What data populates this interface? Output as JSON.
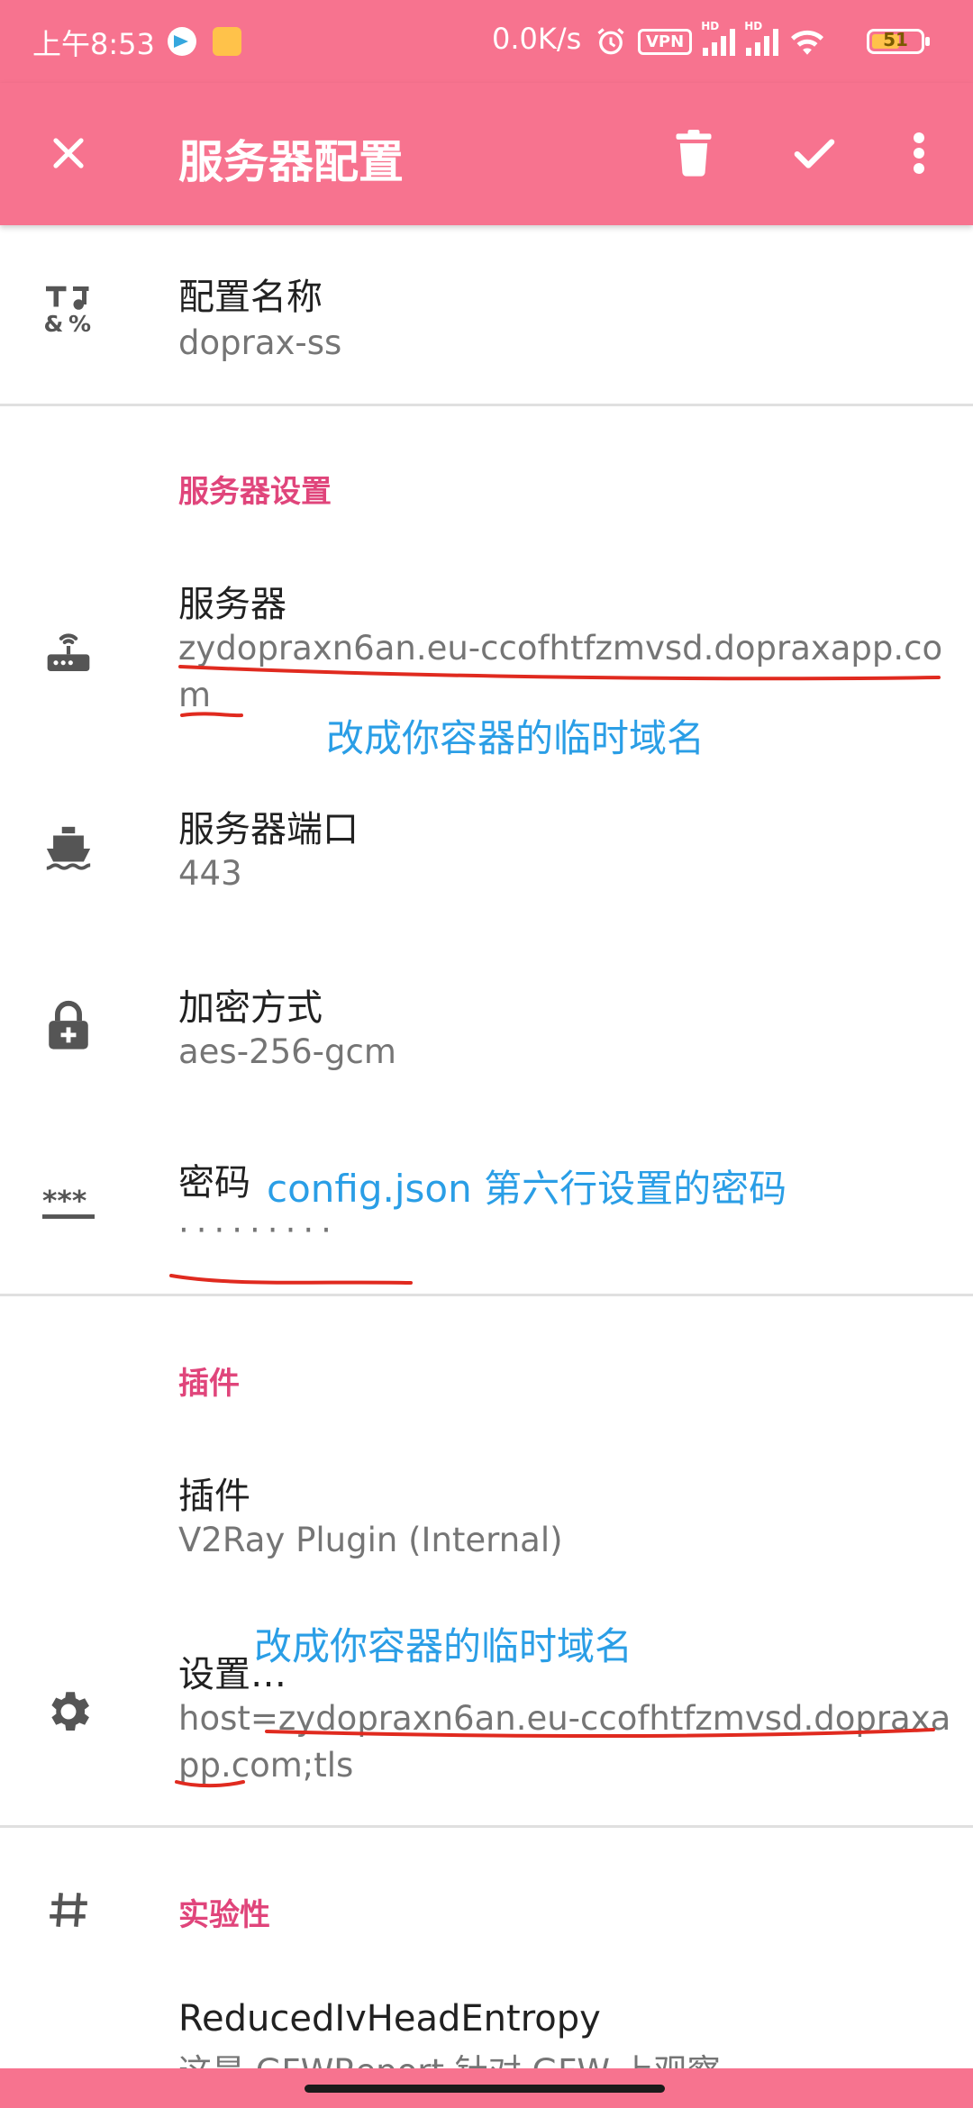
{
  "status_bar": {
    "time": "上午8:53",
    "net_speed": "0.0K/s",
    "vpn_label": "VPN",
    "hd_label": "HD",
    "battery_level": "51"
  },
  "toolbar": {
    "title": "服务器配置",
    "close_icon": "close-icon",
    "delete_icon": "trash-icon",
    "save_icon": "check-icon",
    "more_icon": "more-vert-icon"
  },
  "profile": {
    "name_title": "配置名称",
    "name_value": "doprax-ss"
  },
  "server_section": {
    "header": "服务器设置",
    "server_title": "服务器",
    "server_value": "zydopraxn6an.eu-ccofhtfzmvsd.dopraxapp.com",
    "port_title": "服务器端口",
    "port_value": "443",
    "method_title": "加密方式",
    "method_value": "aes-256-gcm",
    "password_title": "密码",
    "password_value": "·········"
  },
  "plugin_section": {
    "header": "插件",
    "plugin_title": "插件",
    "plugin_value": "V2Ray Plugin (Internal)",
    "config_title": "设置…",
    "config_value": "host=zydopraxn6an.eu-ccofhtfzmvsd.dopraxapp.com;tls"
  },
  "experimental_section": {
    "header": "实验性",
    "reduced_title": "ReducedIvHeadEntropy",
    "reduced_summary": "这是 GFWReport 针对 GFW 上观察"
  },
  "annotations": {
    "server_note": "改成你容器的临时域名",
    "password_note": "config.json 第六行设置的密码",
    "plugin_note": "改成你容器的临时域名"
  },
  "colors": {
    "accent": "#f7738f",
    "section_header": "#e0457b",
    "annotation_text": "#2a9ee6",
    "annotation_underline": "#e02a1f",
    "icon": "#555555"
  }
}
